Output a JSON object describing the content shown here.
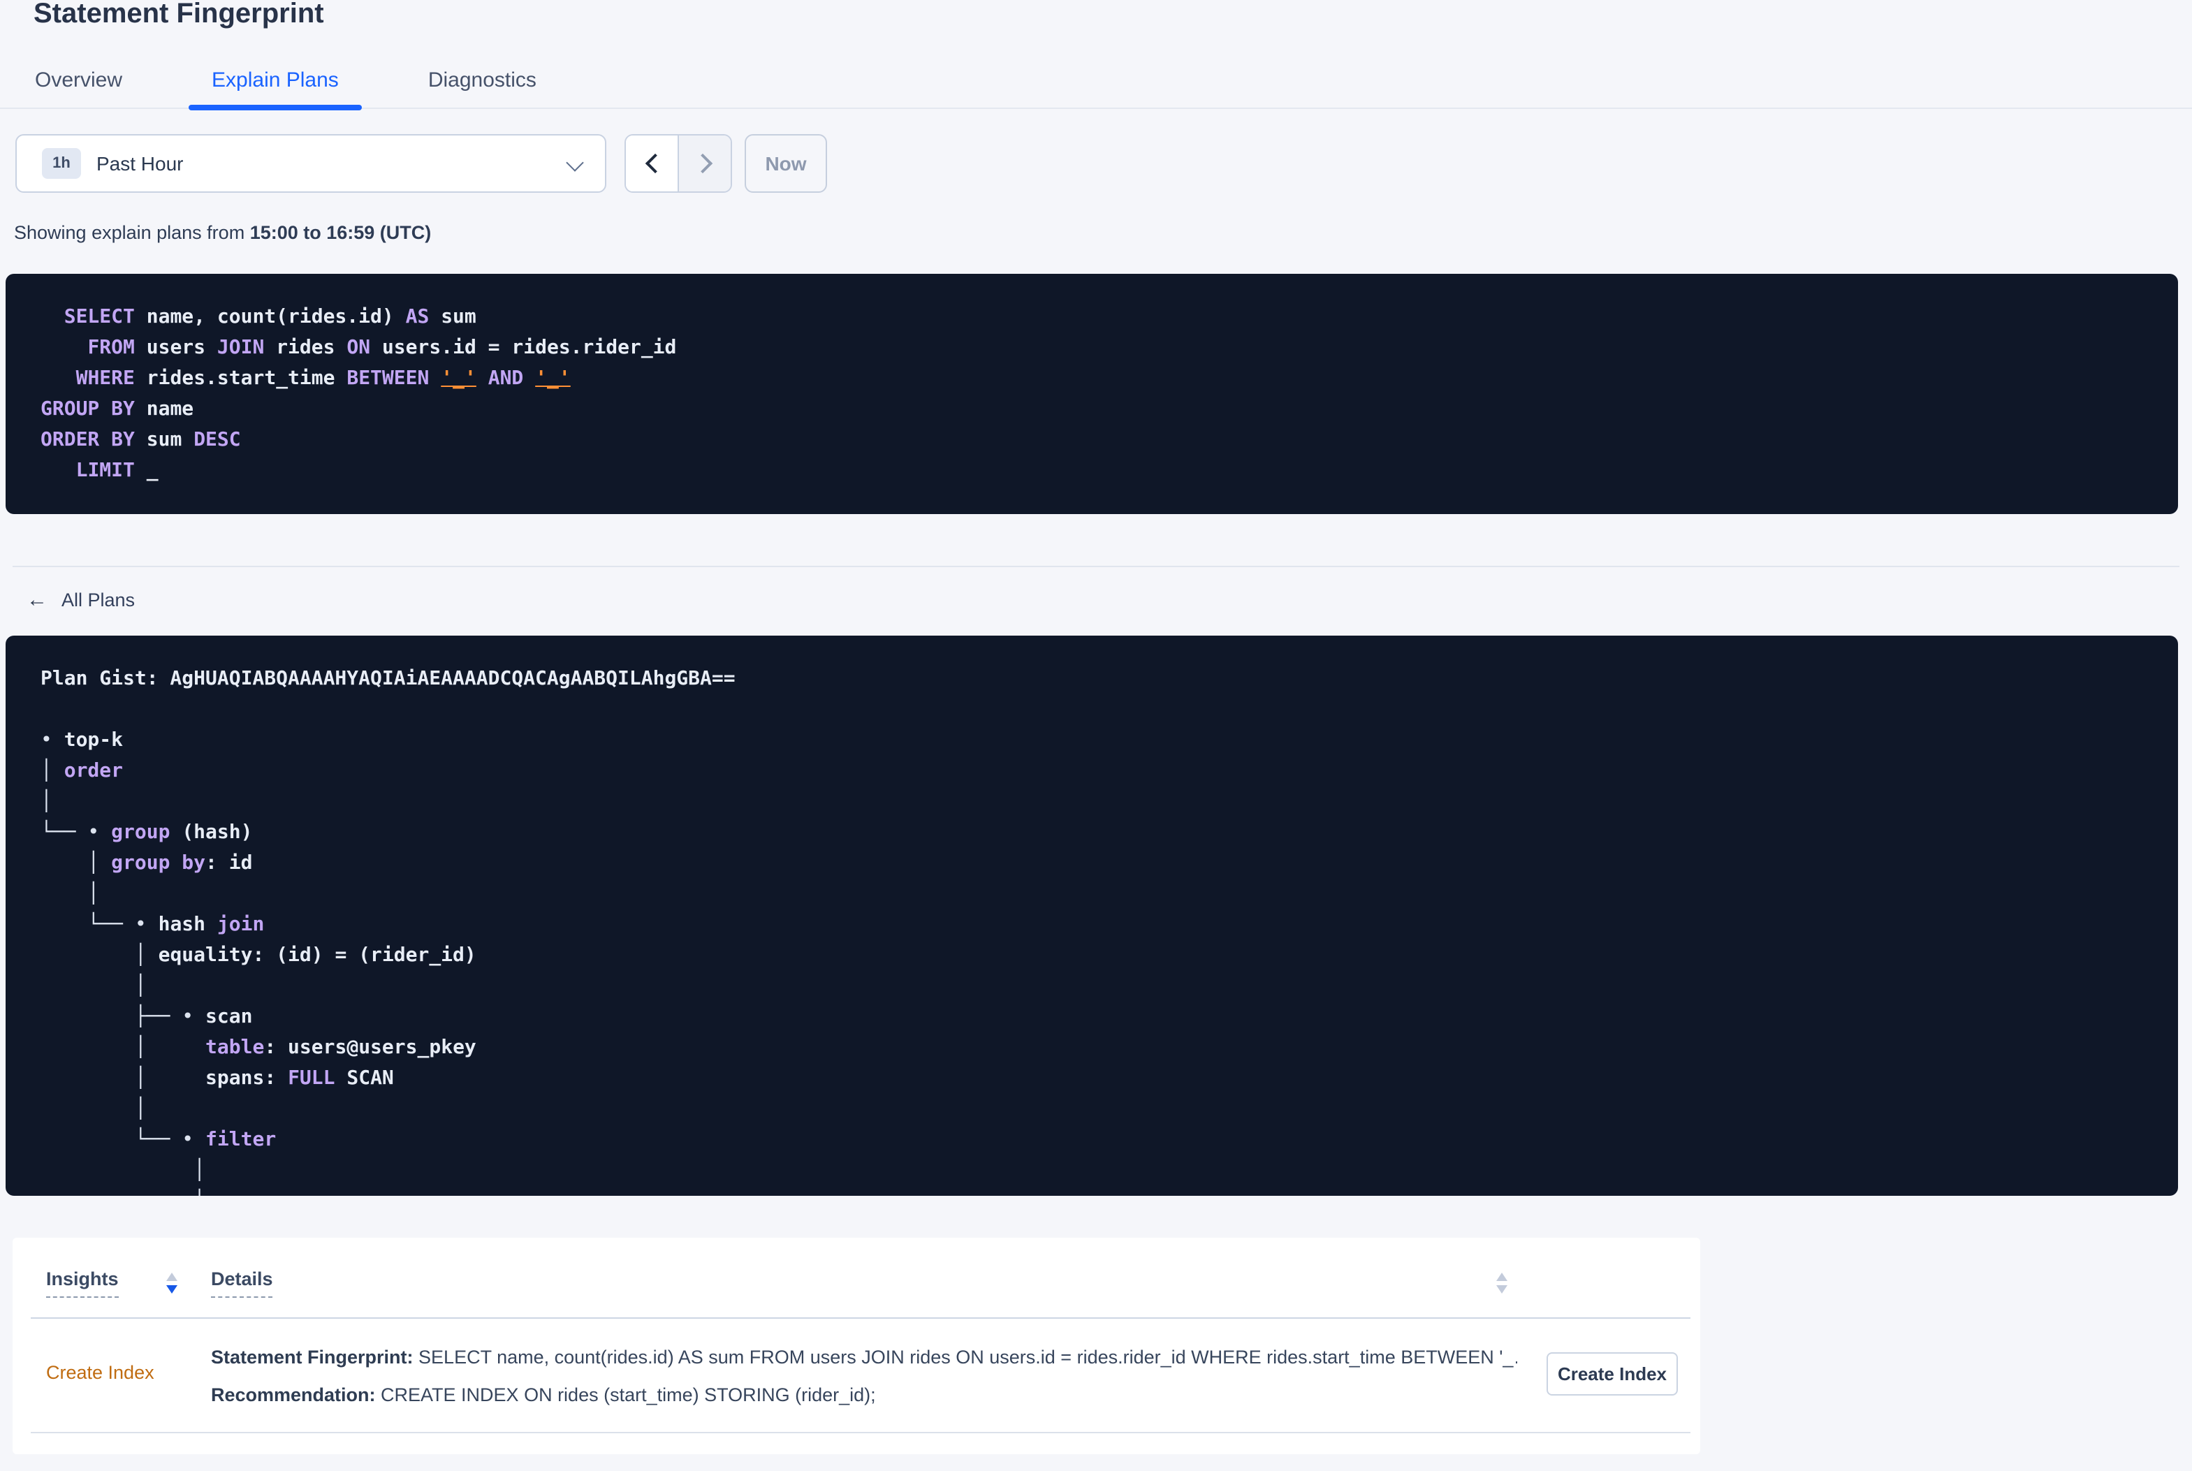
{
  "page": {
    "title": "Statement Fingerprint"
  },
  "tabs": [
    {
      "label": "Overview",
      "active": false
    },
    {
      "label": "Explain Plans",
      "active": true
    },
    {
      "label": "Diagnostics",
      "active": false
    }
  ],
  "time_picker": {
    "range_badge": "1h",
    "range_label": "Past Hour",
    "now_label": "Now"
  },
  "summary": {
    "prefix": "Showing explain plans from ",
    "range": "15:00 to 16:59 (UTC)"
  },
  "sql_block": {
    "lines": [
      [
        [
          "",
          "  "
        ],
        [
          "kw",
          "SELECT"
        ],
        [
          "",
          " name, count(rides.id) "
        ],
        [
          "kw",
          "AS"
        ],
        [
          "",
          " sum"
        ]
      ],
      [
        [
          "",
          "    "
        ],
        [
          "kw",
          "FROM"
        ],
        [
          "",
          " users "
        ],
        [
          "kw",
          "JOIN"
        ],
        [
          "",
          " rides "
        ],
        [
          "kw",
          "ON"
        ],
        [
          "",
          " users.id = rides.rider_id"
        ]
      ],
      [
        [
          "",
          "   "
        ],
        [
          "kw",
          "WHERE"
        ],
        [
          "",
          " rides.start_time "
        ],
        [
          "kw",
          "BETWEEN"
        ],
        [
          "",
          " "
        ],
        [
          "lit",
          "'_'"
        ],
        [
          "",
          " "
        ],
        [
          "kw",
          "AND"
        ],
        [
          "",
          " "
        ],
        [
          "lit",
          "'_'"
        ]
      ],
      [
        [
          "kw",
          "GROUP BY"
        ],
        [
          "",
          " name"
        ]
      ],
      [
        [
          "kw",
          "ORDER BY"
        ],
        [
          "",
          " sum "
        ],
        [
          "kw",
          "DESC"
        ]
      ],
      [
        [
          "",
          "   "
        ],
        [
          "kw",
          "LIMIT"
        ],
        [
          "",
          " _"
        ]
      ]
    ]
  },
  "all_plans": {
    "arrow": "←",
    "label": "All Plans"
  },
  "gist_block": {
    "lines": [
      [
        [
          "",
          "Plan Gist: AgHUAQIABQAAAAHYAQIAiAEAAAADCQACAgAABQILAhgGBA=="
        ]
      ],
      [
        [
          "",
          ""
        ]
      ],
      [
        [
          "st",
          "• "
        ],
        [
          "",
          "top-k"
        ]
      ],
      [
        [
          "st",
          "│ "
        ],
        [
          "kw",
          "order"
        ]
      ],
      [
        [
          "st",
          "│"
        ]
      ],
      [
        [
          "st",
          "└── • "
        ],
        [
          "kw",
          "group"
        ],
        [
          "",
          " (hash)"
        ]
      ],
      [
        [
          "st",
          "    │ "
        ],
        [
          "kw",
          "group by"
        ],
        [
          "",
          ": id"
        ]
      ],
      [
        [
          "st",
          "    │"
        ]
      ],
      [
        [
          "st",
          "    └── • "
        ],
        [
          "",
          "hash "
        ],
        [
          "kw",
          "join"
        ]
      ],
      [
        [
          "st",
          "        │ "
        ],
        [
          "",
          "equality: (id) = (rider_id)"
        ]
      ],
      [
        [
          "st",
          "        │"
        ]
      ],
      [
        [
          "st",
          "        ├── • "
        ],
        [
          "",
          "scan"
        ]
      ],
      [
        [
          "st",
          "        │     "
        ],
        [
          "kw",
          "table"
        ],
        [
          "",
          ": users@users_pkey"
        ]
      ],
      [
        [
          "st",
          "        │     "
        ],
        [
          "",
          "spans: "
        ],
        [
          "kw",
          "FULL"
        ],
        [
          "",
          " SCAN"
        ]
      ],
      [
        [
          "st",
          "        │"
        ]
      ],
      [
        [
          "st",
          "        └── • "
        ],
        [
          "kw",
          "filter"
        ]
      ],
      [
        [
          "st",
          "             │"
        ]
      ],
      [
        [
          "st",
          "             │"
        ]
      ]
    ]
  },
  "insights_table": {
    "columns": [
      "Insights",
      "Details"
    ],
    "rows": [
      {
        "insight": "Create Index",
        "fingerprint_label": "Statement Fingerprint:",
        "fingerprint_text": " SELECT name, count(rides.id) AS sum FROM users JOIN rides ON users.id = rides.rider_id WHERE rides.start_time BETWEEN '_…",
        "recommendation_label": "Recommendation:",
        "recommendation_text": " CREATE INDEX ON rides (start_time) STORING (rider_id);",
        "action_label": "Create Index"
      }
    ]
  },
  "colors": {
    "accent_blue": "#1a63ff",
    "sorter_blue": "#1758e7",
    "code_background": "#0f1728",
    "keyword_purple": "#c2a6f4",
    "literal_orange": "#ff9036",
    "insight_orange": "#c06c11",
    "page_background": "#f5f6fa"
  }
}
